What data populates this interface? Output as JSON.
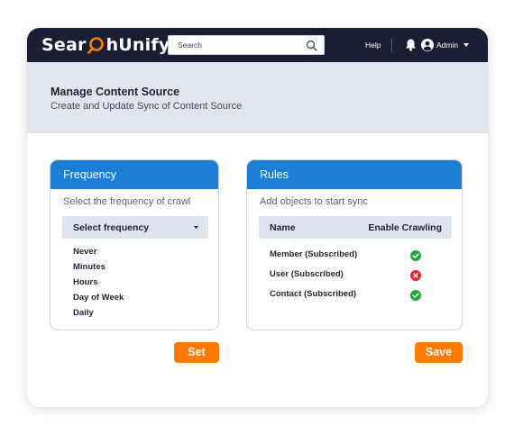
{
  "app": {
    "logo_text_left": "Sear",
    "logo_text_right": "hUnify",
    "brand_colors": {
      "navy": "#1a1e35",
      "orange": "#ff7a00",
      "blue": "#1c7fd6"
    }
  },
  "topbar": {
    "search_placeholder": "Search",
    "help_label": "Help",
    "user_label": "Admin",
    "icons": [
      "search-icon",
      "bell-icon",
      "user-icon",
      "chevron-down-icon"
    ]
  },
  "page": {
    "title": "Manage Content Source",
    "subtitle": "Create and Update Sync of Content Source"
  },
  "frequency": {
    "title": "Frequency",
    "description": "Select the frequency of crawl",
    "select_label": "Select frequency",
    "options": [
      "Never",
      "Minutes",
      "Hours",
      "Day of Week",
      "Daily"
    ],
    "button_label": "Set"
  },
  "rules": {
    "title": "Rules",
    "description": "Add objects to start sync",
    "columns": [
      "Name",
      "Enable Crawling"
    ],
    "rows": [
      {
        "name": "Member (Subscribed)",
        "enabled": true
      },
      {
        "name": "User (Subscribed)",
        "enabled": false
      },
      {
        "name": "Contact (Subscribed)",
        "enabled": true
      }
    ],
    "status_colors": {
      "enabled": "#1faa3a",
      "disabled": "#e3252b"
    },
    "button_label": "Save"
  }
}
